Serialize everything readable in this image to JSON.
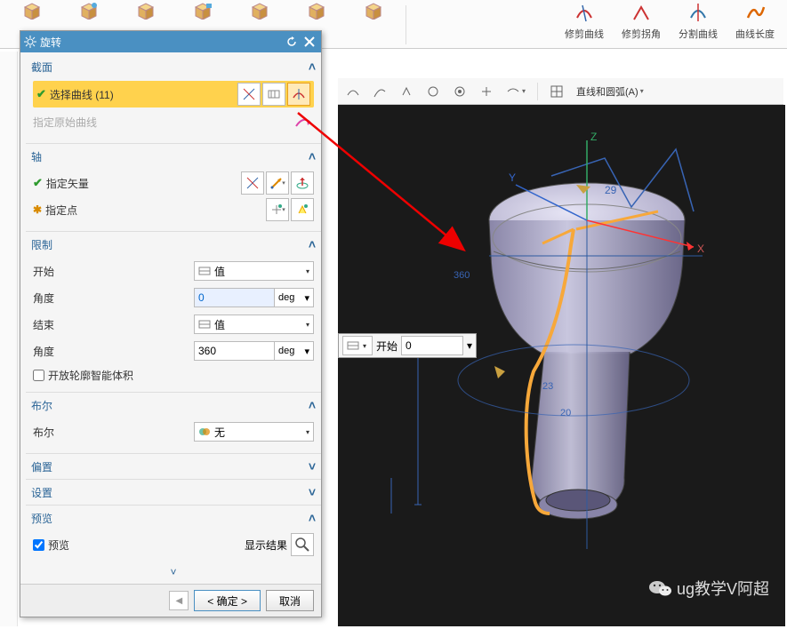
{
  "ribbon": {
    "items_left": [
      {
        "label": "",
        "icon": "cube1"
      },
      {
        "label": "",
        "icon": "cube2"
      },
      {
        "label": "",
        "icon": "cube3"
      },
      {
        "label": "",
        "icon": "cube4"
      },
      {
        "label": "",
        "icon": "cube5"
      },
      {
        "label": "",
        "icon": "cube6"
      },
      {
        "label": "",
        "icon": "cube7"
      }
    ],
    "items_right": [
      {
        "label": "修剪曲线",
        "icon": "trim-curve",
        "color": "#c33"
      },
      {
        "label": "修剪拐角",
        "icon": "trim-corner",
        "color": "#c33"
      },
      {
        "label": "分割曲线",
        "icon": "split-curve",
        "color": "#37a"
      },
      {
        "label": "曲线长度",
        "icon": "curve-length",
        "color": "#d60"
      }
    ]
  },
  "toolbar2": {
    "right_label": "直线和圆弧(A)"
  },
  "dialog": {
    "title": "旋转",
    "sections": {
      "section1": {
        "title": "截面",
        "select_curve": "选择曲线 (11)",
        "origin_curve": "指定原始曲线"
      },
      "axis": {
        "title": "轴",
        "vector": "指定矢量",
        "point": "指定点"
      },
      "limits": {
        "title": "限制",
        "start_label": "开始",
        "start_type": "值",
        "start_angle_label": "角度",
        "start_angle_value": "0",
        "start_angle_unit": "deg",
        "end_label": "结束",
        "end_type": "值",
        "end_angle_label": "角度",
        "end_angle_value": "360",
        "end_angle_unit": "deg",
        "open_contour": "开放轮廓智能体积"
      },
      "boolean": {
        "title": "布尔",
        "label": "布尔",
        "value": "无"
      },
      "offset": {
        "title": "偏置"
      },
      "settings": {
        "title": "设置"
      },
      "preview": {
        "title": "预览",
        "checkbox": "预览",
        "show_result": "显示结果"
      }
    },
    "buttons": {
      "ok": "< 确定 >",
      "cancel": "取消"
    }
  },
  "float": {
    "label": "开始",
    "value": "0"
  },
  "watermark": "ug教学V阿超",
  "viewport": {
    "dims": [
      "29",
      "23",
      "20"
    ],
    "axes": [
      "X",
      "Y",
      "Z"
    ]
  }
}
